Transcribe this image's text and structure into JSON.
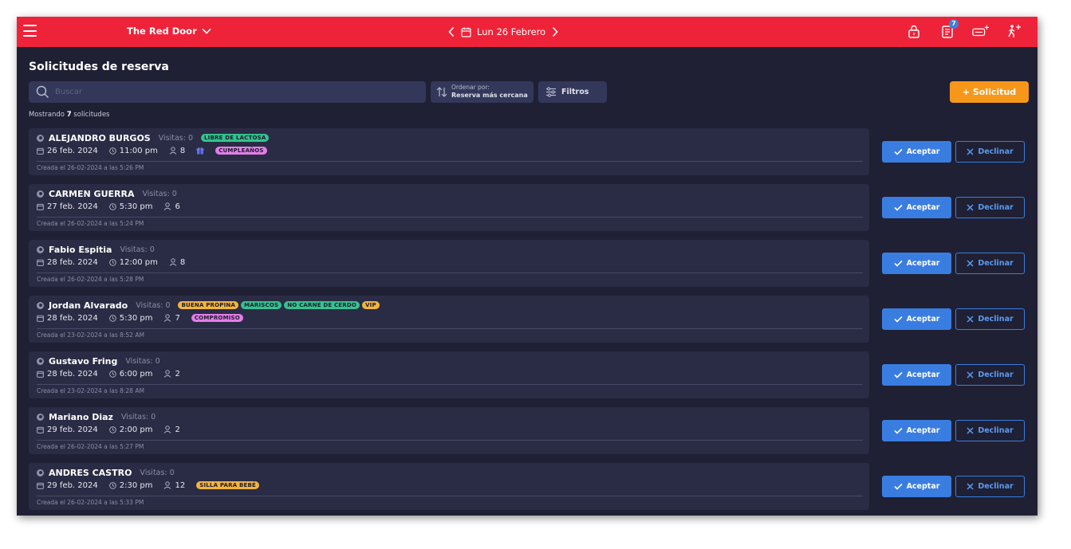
{
  "header": {
    "venue": "The Red Door",
    "date": "Lun 26 Febrero",
    "notifications": "7",
    "icons": [
      "lock-icon",
      "reservations-icon",
      "add-table-icon",
      "walk-in-icon"
    ]
  },
  "page": {
    "title": "Solicitudes de reserva",
    "search_placeholder": "Buscar",
    "sort_label": "Ordenar por:",
    "sort_value": "Reserva más cercana",
    "filters_label": "Filtros",
    "new_request_label": "+ Solicitud",
    "showing_prefix": "Mostrando ",
    "showing_count": "7",
    "showing_suffix": " solicitudes"
  },
  "actions": {
    "accept": "Aceptar",
    "decline": "Declinar"
  },
  "colors": {
    "brand_red": "#ee2339",
    "accent_blue": "#3a7de1",
    "accent_orange": "#f7971a",
    "tag_green": "#34c38f",
    "tag_yellow": "#f3b43f",
    "tag_pink": "#e47ee8"
  },
  "requests": [
    {
      "name": "ALEJANDRO BURGOS",
      "visits": "Visitas: 0",
      "date": "26 feb. 2024",
      "time": "11:00 pm",
      "guests": "8",
      "created": "Creada el 26-02-2024 a las 5:26 PM",
      "gift": true,
      "tags1": [
        {
          "label": "LIBRE DE LACTOSA",
          "color": "#34c38f"
        }
      ],
      "tags2": [
        {
          "label": "CUMPLEAÑOS",
          "color": "#e47ee8"
        }
      ]
    },
    {
      "name": "CARMEN GUERRA",
      "visits": "Visitas: 0",
      "date": "27 feb. 2024",
      "time": "5:30 pm",
      "guests": "6",
      "created": "Creada el 26-02-2024 a las 5:24 PM",
      "gift": false,
      "tags1": [],
      "tags2": []
    },
    {
      "name": "Fabio Espitia",
      "visits": "Visitas: 0",
      "date": "28 feb. 2024",
      "time": "12:00 pm",
      "guests": "8",
      "created": "Creada el 26-02-2024 a las 5:28 PM",
      "gift": false,
      "tags1": [],
      "tags2": []
    },
    {
      "name": "Jordan Alvarado",
      "visits": "Visitas: 0",
      "date": "28 feb. 2024",
      "time": "5:30 pm",
      "guests": "7",
      "created": "Creada el 23-02-2024 a las 8:52 AM",
      "gift": false,
      "tags1": [
        {
          "label": "BUENA PROPINA",
          "color": "#f3b43f"
        },
        {
          "label": "MARISCOS",
          "color": "#34c38f"
        },
        {
          "label": "NO CARNE DE CERDO",
          "color": "#34c38f"
        },
        {
          "label": "VIP",
          "color": "#f3b43f"
        }
      ],
      "tags2": [
        {
          "label": "COMPROMISO",
          "color": "#e47ee8"
        }
      ]
    },
    {
      "name": "Gustavo Fring",
      "visits": "Visitas: 0",
      "date": "28 feb. 2024",
      "time": "6:00 pm",
      "guests": "2",
      "created": "Creada el 23-02-2024 a las 8:28 AM",
      "gift": false,
      "tags1": [],
      "tags2": []
    },
    {
      "name": "Mariano Diaz",
      "visits": "Visitas: 0",
      "date": "29 feb. 2024",
      "time": "2:00 pm",
      "guests": "2",
      "created": "Creada el 26-02-2024 a las 5:27 PM",
      "gift": false,
      "tags1": [],
      "tags2": []
    },
    {
      "name": "ANDRES CASTRO",
      "visits": "Visitas: 0",
      "date": "29 feb. 2024",
      "time": "2:30 pm",
      "guests": "12",
      "created": "Creada el 26-02-2024 a las 5:33 PM",
      "gift": false,
      "tags1": [],
      "tags2": [
        {
          "label": "SILLA PARA BEBÉ",
          "color": "#f3b43f"
        }
      ]
    }
  ]
}
